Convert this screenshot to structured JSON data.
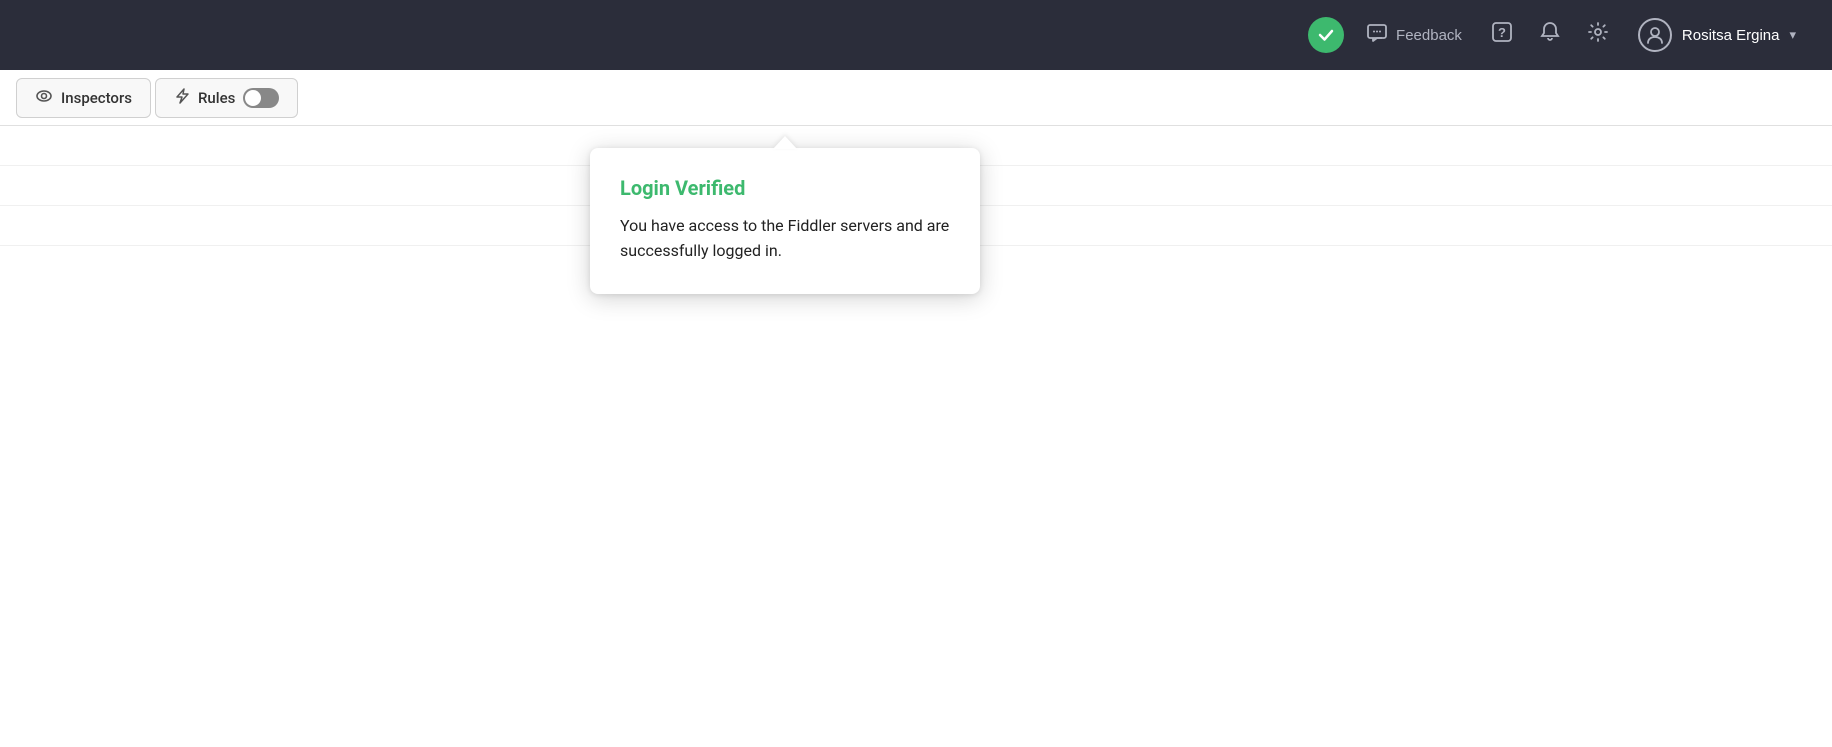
{
  "navbar": {
    "verified_icon_title": "Login Verified",
    "feedback_label": "Feedback",
    "help_icon": "?",
    "bell_icon": "🔔",
    "settings_icon": "⚙",
    "user_name": "Rositsa Ergina",
    "dropdown_icon": "▾",
    "accent_green": "#3db96e"
  },
  "popup": {
    "title": "Login Verified",
    "body": "You have access to the Fiddler servers and are successfully logged in."
  },
  "tabs": [
    {
      "id": "inspectors",
      "label": "Inspectors",
      "icon": "eye"
    },
    {
      "id": "rules",
      "label": "Rules",
      "icon": "bolt",
      "toggle": false
    }
  ]
}
